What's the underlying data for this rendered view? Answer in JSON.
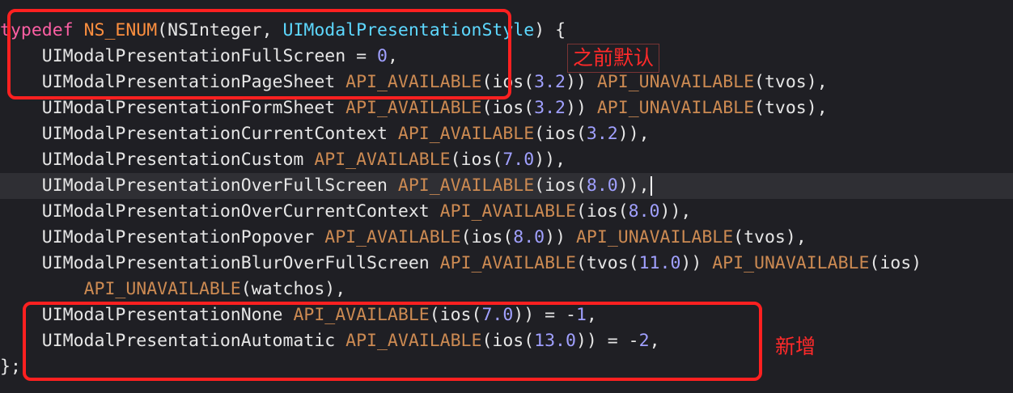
{
  "code": {
    "lines": [
      [
        {
          "t": "typedef",
          "c": "kw"
        },
        {
          "t": " ",
          "c": "plain"
        },
        {
          "t": "NS_ENUM",
          "c": "macro"
        },
        {
          "t": "(NSInteger, ",
          "c": "plain"
        },
        {
          "t": "UIModalPresentationStyle",
          "c": "type"
        },
        {
          "t": ") {",
          "c": "plain"
        }
      ],
      [
        {
          "t": "    UIModalPresentationFullScreen = ",
          "c": "plain"
        },
        {
          "t": "0",
          "c": "num"
        },
        {
          "t": ",",
          "c": "plain"
        }
      ],
      [
        {
          "t": "    UIModalPresentationPageSheet ",
          "c": "plain"
        },
        {
          "t": "API_AVAILABLE",
          "c": "avail"
        },
        {
          "t": "(ios(",
          "c": "plain"
        },
        {
          "t": "3.2",
          "c": "num"
        },
        {
          "t": ")) ",
          "c": "plain"
        },
        {
          "t": "API_UNAVAILABLE",
          "c": "avail"
        },
        {
          "t": "(tvos),",
          "c": "plain"
        }
      ],
      [
        {
          "t": "    UIModalPresentationFormSheet ",
          "c": "plain"
        },
        {
          "t": "API_AVAILABLE",
          "c": "avail"
        },
        {
          "t": "(ios(",
          "c": "plain"
        },
        {
          "t": "3.2",
          "c": "num"
        },
        {
          "t": ")) ",
          "c": "plain"
        },
        {
          "t": "API_UNAVAILABLE",
          "c": "avail"
        },
        {
          "t": "(tvos),",
          "c": "plain"
        }
      ],
      [
        {
          "t": "    UIModalPresentationCurrentContext ",
          "c": "plain"
        },
        {
          "t": "API_AVAILABLE",
          "c": "avail"
        },
        {
          "t": "(ios(",
          "c": "plain"
        },
        {
          "t": "3.2",
          "c": "num"
        },
        {
          "t": ")),",
          "c": "plain"
        }
      ],
      [
        {
          "t": "    UIModalPresentationCustom ",
          "c": "plain"
        },
        {
          "t": "API_AVAILABLE",
          "c": "avail"
        },
        {
          "t": "(ios(",
          "c": "plain"
        },
        {
          "t": "7.0",
          "c": "num"
        },
        {
          "t": ")),",
          "c": "plain"
        }
      ],
      [
        {
          "t": "    UIModalPresentationOverFullScreen ",
          "c": "plain"
        },
        {
          "t": "API_AVAILABLE",
          "c": "avail"
        },
        {
          "t": "(ios(",
          "c": "plain"
        },
        {
          "t": "8.0",
          "c": "num"
        },
        {
          "t": ")),",
          "c": "plain"
        }
      ],
      [
        {
          "t": "    UIModalPresentationOverCurrentContext ",
          "c": "plain"
        },
        {
          "t": "API_AVAILABLE",
          "c": "avail"
        },
        {
          "t": "(ios(",
          "c": "plain"
        },
        {
          "t": "8.0",
          "c": "num"
        },
        {
          "t": ")),",
          "c": "plain"
        }
      ],
      [
        {
          "t": "    UIModalPresentationPopover ",
          "c": "plain"
        },
        {
          "t": "API_AVAILABLE",
          "c": "avail"
        },
        {
          "t": "(ios(",
          "c": "plain"
        },
        {
          "t": "8.0",
          "c": "num"
        },
        {
          "t": ")) ",
          "c": "plain"
        },
        {
          "t": "API_UNAVAILABLE",
          "c": "avail"
        },
        {
          "t": "(tvos),",
          "c": "plain"
        }
      ],
      [
        {
          "t": "    UIModalPresentationBlurOverFullScreen ",
          "c": "plain"
        },
        {
          "t": "API_AVAILABLE",
          "c": "avail"
        },
        {
          "t": "(tvos(",
          "c": "plain"
        },
        {
          "t": "11.0",
          "c": "num"
        },
        {
          "t": ")) ",
          "c": "plain"
        },
        {
          "t": "API_UNAVAILABLE",
          "c": "avail"
        },
        {
          "t": "(ios)",
          "c": "plain"
        }
      ],
      [
        {
          "t": "        ",
          "c": "plain"
        },
        {
          "t": "API_UNAVAILABLE",
          "c": "avail"
        },
        {
          "t": "(watchos),",
          "c": "plain"
        }
      ],
      [
        {
          "t": "    UIModalPresentationNone ",
          "c": "plain"
        },
        {
          "t": "API_AVAILABLE",
          "c": "avail"
        },
        {
          "t": "(ios(",
          "c": "plain"
        },
        {
          "t": "7.0",
          "c": "num"
        },
        {
          "t": ")) = -",
          "c": "plain"
        },
        {
          "t": "1",
          "c": "num"
        },
        {
          "t": ",",
          "c": "plain"
        }
      ],
      [
        {
          "t": "    UIModalPresentationAutomatic ",
          "c": "plain"
        },
        {
          "t": "API_AVAILABLE",
          "c": "avail"
        },
        {
          "t": "(ios(",
          "c": "plain"
        },
        {
          "t": "13.0",
          "c": "num"
        },
        {
          "t": ")) = -",
          "c": "plain"
        },
        {
          "t": "2",
          "c": "num"
        },
        {
          "t": ",",
          "c": "plain"
        }
      ],
      [
        {
          "t": "",
          "c": "plain"
        }
      ],
      [
        {
          "t": "};",
          "c": "plain"
        }
      ]
    ],
    "current_line": 6
  },
  "annotations": {
    "previous_default": "之前默认",
    "newly_added": "新增"
  },
  "colors": {
    "background": "#1f1f24",
    "keyword": "#fc5fa3",
    "macro": "#fd8f3f",
    "type": "#5dd8ff",
    "number": "#a0a0ff",
    "availability": "#cc8a52",
    "plain": "#e6e6e6",
    "annotation": "#ff2020"
  }
}
